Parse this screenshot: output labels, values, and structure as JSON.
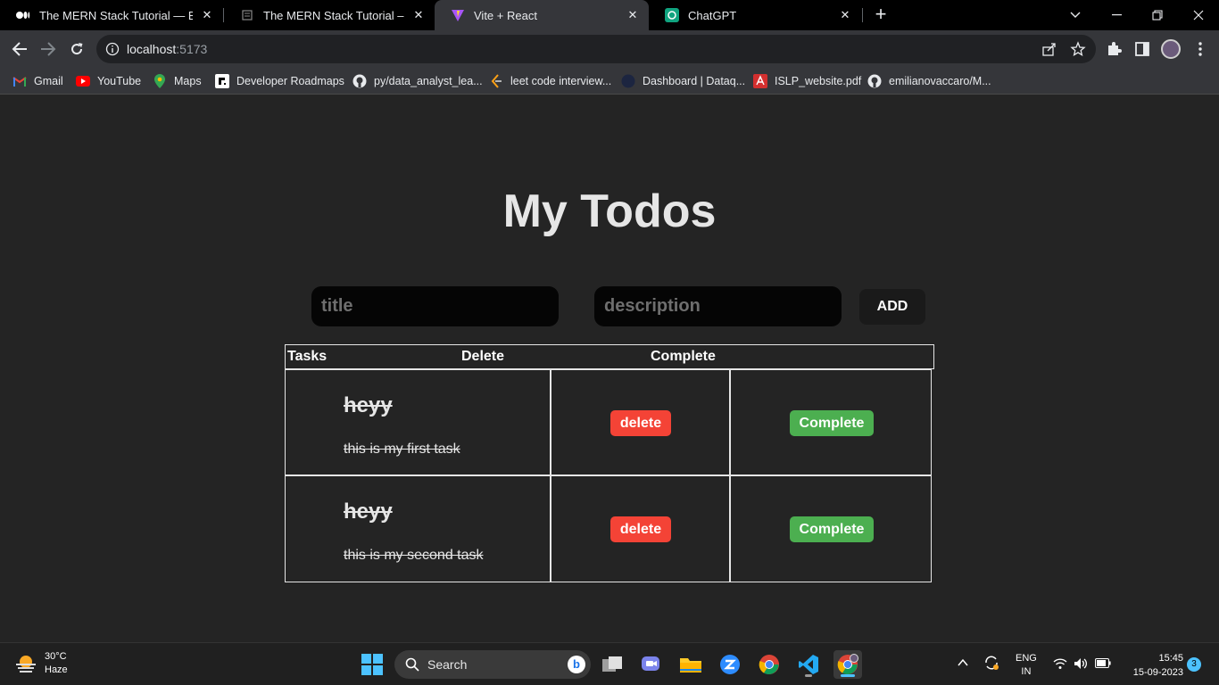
{
  "tabs": [
    {
      "title": "The MERN Stack Tutorial — Build",
      "icon": "medium-icon"
    },
    {
      "title": "The MERN Stack Tutorial – Buildin",
      "icon": "page-icon"
    },
    {
      "title": "Vite + React",
      "icon": "vite-icon"
    },
    {
      "title": "ChatGPT",
      "icon": "chatgpt-icon"
    }
  ],
  "address_bar": {
    "host": "localhost",
    "port": ":5173"
  },
  "bookmarks": [
    {
      "label": "Gmail",
      "icon": "gmail-icon"
    },
    {
      "label": "YouTube",
      "icon": "youtube-icon"
    },
    {
      "label": "Maps",
      "icon": "maps-icon"
    },
    {
      "label": "Developer Roadmaps",
      "icon": "roadmap-icon"
    },
    {
      "label": "py/data_analyst_lea...",
      "icon": "github-icon"
    },
    {
      "label": "leet code interview...",
      "icon": "leetcode-icon"
    },
    {
      "label": "Dashboard | Dataq...",
      "icon": "dataquest-icon"
    },
    {
      "label": "ISLP_website.pdf",
      "icon": "pdf-icon"
    },
    {
      "label": "emilianovaccaro/M...",
      "icon": "github-icon"
    }
  ],
  "app": {
    "heading": "My Todos",
    "title_placeholder": "title",
    "description_placeholder": "description",
    "add_label": "ADD",
    "columns": {
      "tasks": "Tasks",
      "delete": "Delete",
      "complete": "Complete"
    },
    "todos": [
      {
        "title": "heyy",
        "description": "this is my first task",
        "delete_label": "delete",
        "complete_label": "Complete"
      },
      {
        "title": "heyy",
        "description": "this is my second task",
        "delete_label": "delete",
        "complete_label": "Complete"
      }
    ]
  },
  "taskbar": {
    "weather": {
      "temp": "30°C",
      "condition": "Haze"
    },
    "search_label": "Search",
    "language": {
      "line1": "ENG",
      "line2": "IN"
    },
    "time": "15:45",
    "date": "15-09-2023",
    "notification_count": "3"
  },
  "colors": {
    "accent": "#4cc2ff",
    "delete": "#f44336",
    "complete": "#4caf50"
  }
}
